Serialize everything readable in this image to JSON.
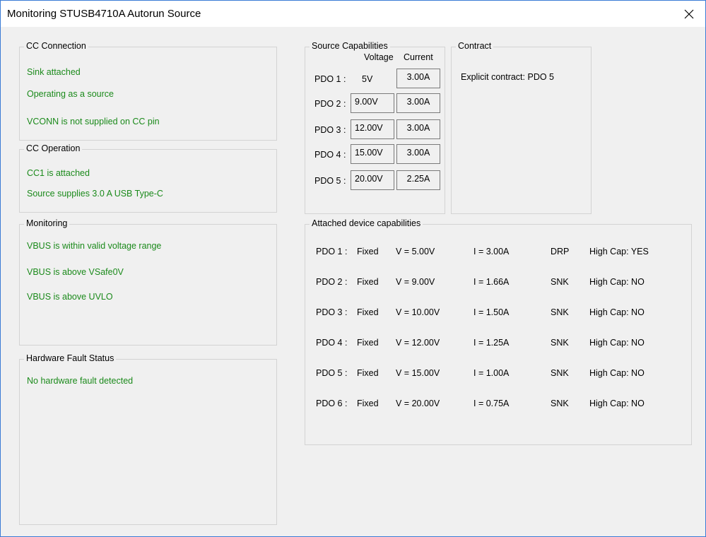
{
  "window": {
    "title": "Monitoring STUSB4710A Autorun Source"
  },
  "cc_connection": {
    "title": "CC Connection",
    "lines": [
      "Sink attached",
      "Operating as a source",
      "VCONN is not supplied on CC pin"
    ]
  },
  "cc_operation": {
    "title": "CC Operation",
    "lines": [
      "CC1 is attached",
      "Source supplies 3.0 A USB Type-C"
    ]
  },
  "monitoring": {
    "title": "Monitoring",
    "lines": [
      "VBUS is within valid voltage range",
      "VBUS is above VSafe0V",
      "VBUS is above UVLO"
    ]
  },
  "hw_fault": {
    "title": "Hardware Fault Status",
    "lines": [
      "No hardware fault detected"
    ]
  },
  "source_caps": {
    "title": "Source Capabilities",
    "col_voltage": "Voltage",
    "col_current": "Current",
    "rows": [
      {
        "label": "PDO 1 :",
        "voltage": "5V",
        "current": "3.00A"
      },
      {
        "label": "PDO 2 :",
        "voltage": "9.00V",
        "current": "3.00A"
      },
      {
        "label": "PDO 3 :",
        "voltage": "12.00V",
        "current": "3.00A"
      },
      {
        "label": "PDO 4 :",
        "voltage": "15.00V",
        "current": "3.00A"
      },
      {
        "label": "PDO 5 :",
        "voltage": "20.00V",
        "current": "2.25A"
      }
    ]
  },
  "contract": {
    "title": "Contract",
    "text": "Explicit contract: PDO 5"
  },
  "attached_caps": {
    "title": "Attached device capabilities",
    "rows": [
      {
        "pdo": "PDO 1 :",
        "type": "Fixed",
        "v": "V = 5.00V",
        "i": "I = 3.00A",
        "role": "DRP",
        "highcap": "High Cap: YES"
      },
      {
        "pdo": "PDO 2 :",
        "type": "Fixed",
        "v": "V = 9.00V",
        "i": "I = 1.66A",
        "role": "SNK",
        "highcap": "High Cap: NO"
      },
      {
        "pdo": "PDO 3 :",
        "type": "Fixed",
        "v": "V = 10.00V",
        "i": "I = 1.50A",
        "role": "SNK",
        "highcap": "High Cap: NO"
      },
      {
        "pdo": "PDO 4 :",
        "type": "Fixed",
        "v": "V = 12.00V",
        "i": "I = 1.25A",
        "role": "SNK",
        "highcap": "High Cap: NO"
      },
      {
        "pdo": "PDO 5 :",
        "type": "Fixed",
        "v": "V = 15.00V",
        "i": "I = 1.00A",
        "role": "SNK",
        "highcap": "High Cap: NO"
      },
      {
        "pdo": "PDO 6 :",
        "type": "Fixed",
        "v": "V = 20.00V",
        "i": "I = 0.75A",
        "role": "SNK",
        "highcap": "High Cap: NO"
      }
    ]
  },
  "icons": {
    "close": "close-icon"
  }
}
